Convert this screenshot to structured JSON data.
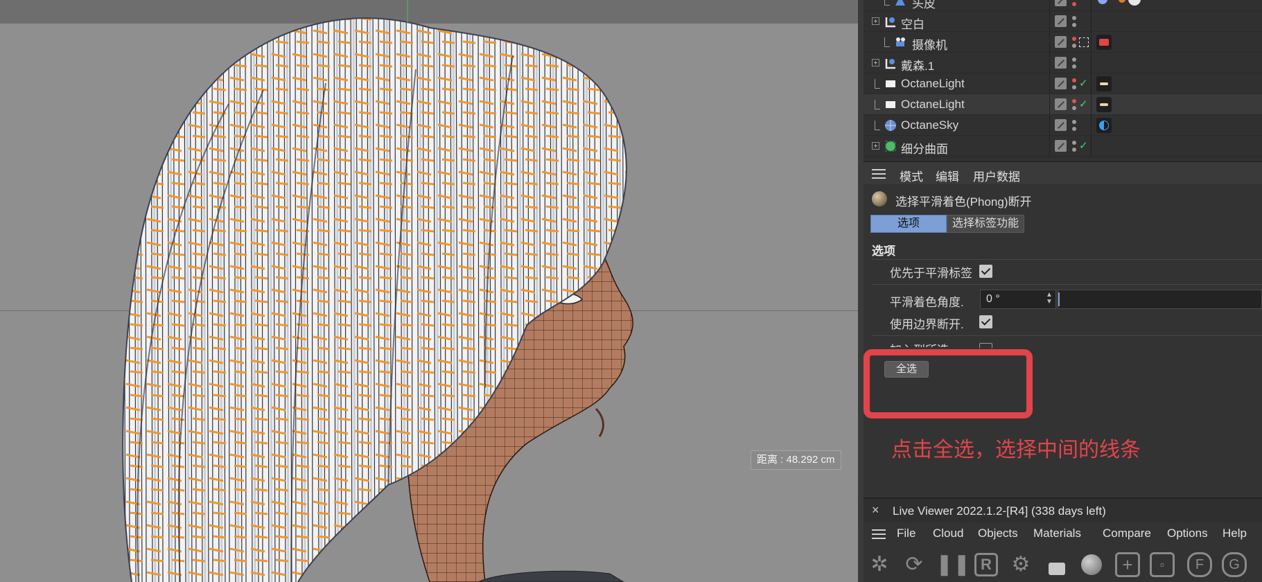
{
  "viewport": {
    "distance_label": "距离 : 48.292 cm"
  },
  "object_manager": {
    "rows": [
      {
        "name": "头皮",
        "icon": "triangle-object-icon"
      },
      {
        "name": "空白",
        "icon": "null-object-icon"
      },
      {
        "name": "摄像机",
        "icon": "camera-icon"
      },
      {
        "name": "戴森.1",
        "icon": "null-object-icon"
      },
      {
        "name": "OctaneLight",
        "icon": "light-icon"
      },
      {
        "name": "OctaneLight",
        "icon": "light-icon"
      },
      {
        "name": "OctaneSky",
        "icon": "sky-icon"
      },
      {
        "name": "细分曲面",
        "icon": "subdivision-surface-icon"
      }
    ]
  },
  "attributes": {
    "menu": [
      "模式",
      "编辑",
      "用户数据"
    ],
    "tag_title": "选择平滑着色(Phong)断开",
    "tabs": [
      "选项",
      "选择标签功能"
    ],
    "section_title": "选项",
    "params": {
      "priority_label": "优先于平滑标签",
      "angle_label": "平滑着色角度.",
      "angle_value": "0 °",
      "border_label": "使用边界断开.",
      "add_label": "加入到所选"
    },
    "select_all_label": "全选",
    "annotation": "点击全选，选择中间的线条"
  },
  "live_viewer": {
    "title": "Live Viewer 2022.1.2-[R4] (338 days left)",
    "close": "×",
    "menu": [
      "File",
      "Cloud",
      "Objects",
      "Materials",
      "Compare",
      "Options",
      "Help"
    ]
  },
  "colors": {
    "accent": "#7d9fd6",
    "annotation_red": "#e2444a",
    "check_green": "#44d46a",
    "hair_orange": "#f0962e",
    "skin": "#b07a5e"
  }
}
